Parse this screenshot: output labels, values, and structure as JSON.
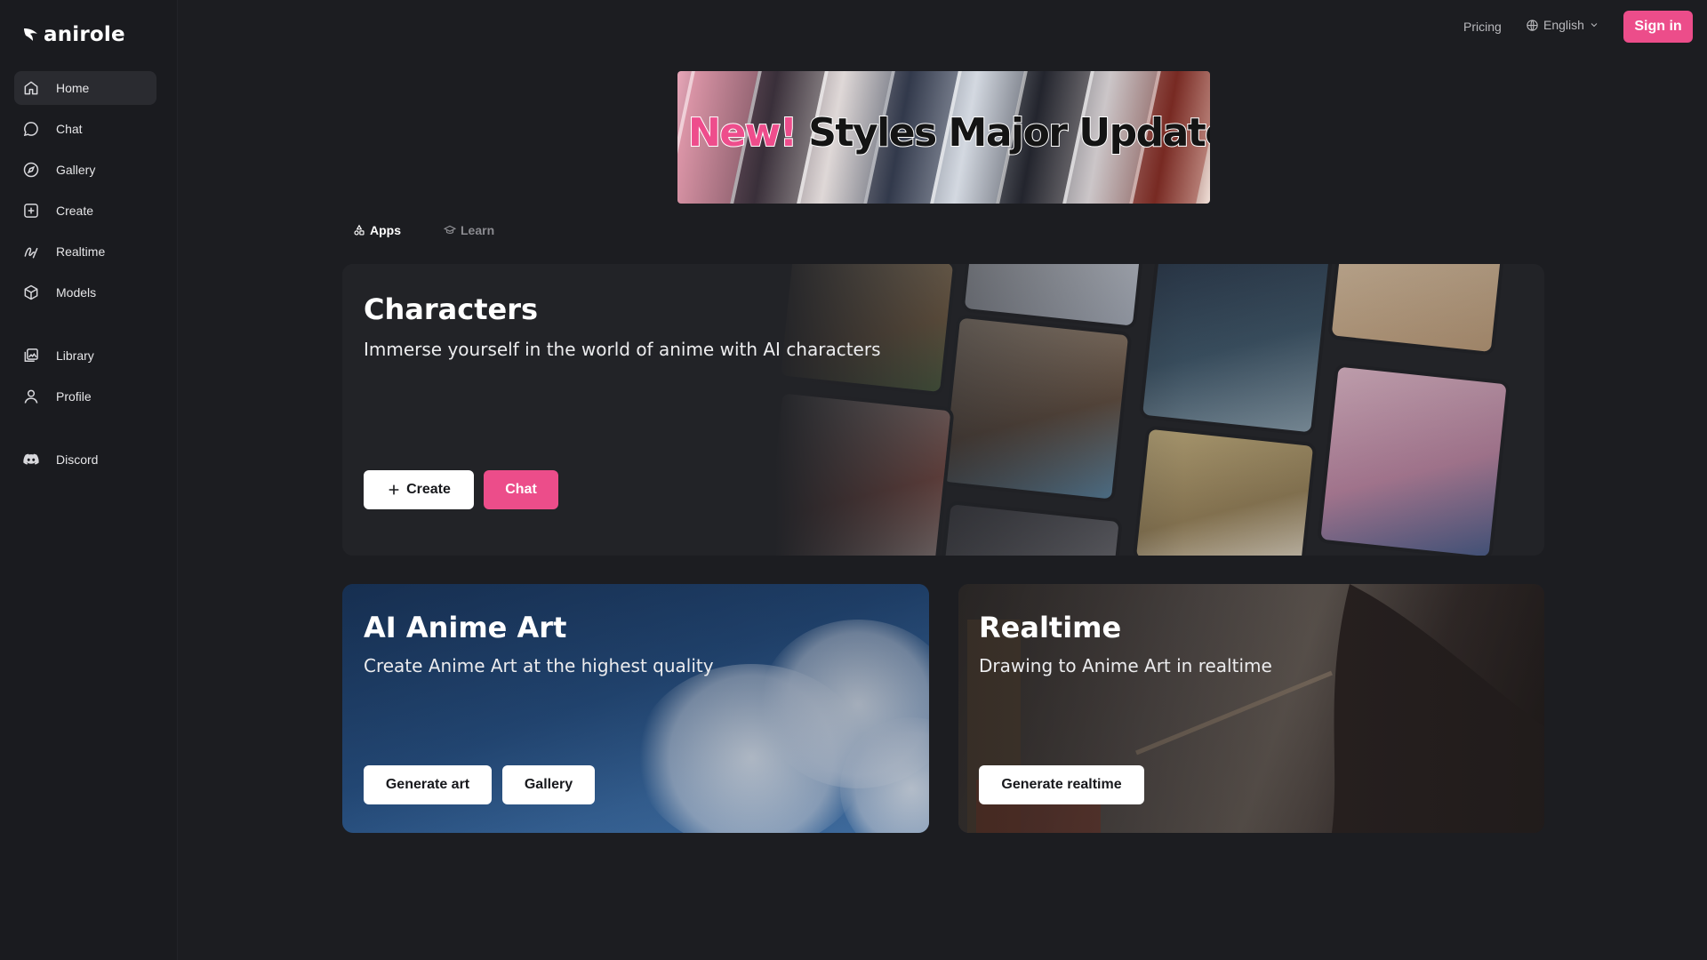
{
  "brand": {
    "name": "anirole"
  },
  "sidebar": {
    "items": [
      {
        "key": "home",
        "label": "Home",
        "icon": "home-icon",
        "active": true
      },
      {
        "key": "chat",
        "label": "Chat",
        "icon": "chat-bubble-icon"
      },
      {
        "key": "gallery",
        "label": "Gallery",
        "icon": "compass-icon"
      },
      {
        "key": "create",
        "label": "Create",
        "icon": "plus-square-icon"
      },
      {
        "key": "realtime",
        "label": "Realtime",
        "icon": "pen-scribble-icon"
      },
      {
        "key": "models",
        "label": "Models",
        "icon": "cube-icon"
      },
      {
        "key": "library",
        "label": "Library",
        "icon": "image-stack-icon"
      },
      {
        "key": "profile",
        "label": "Profile",
        "icon": "user-icon"
      },
      {
        "key": "discord",
        "label": "Discord",
        "icon": "discord-icon"
      }
    ]
  },
  "header": {
    "pricing": "Pricing",
    "language": "English",
    "sign_in": "Sign in"
  },
  "banner": {
    "highlight": "New!",
    "text": "Styles Major Update"
  },
  "tabs": [
    {
      "label": "Apps",
      "icon": "apps-icon",
      "active": true
    },
    {
      "label": "Learn",
      "icon": "graduation-cap-icon",
      "active": false
    }
  ],
  "cards": {
    "characters": {
      "title": "Characters",
      "subtitle": "Immerse yourself in the world of anime with AI characters",
      "create_label": "Create",
      "chat_label": "Chat"
    },
    "art": {
      "title": "AI Anime Art",
      "subtitle": "Create Anime Art at the highest quality",
      "generate_label": "Generate art",
      "gallery_label": "Gallery"
    },
    "realtime": {
      "title": "Realtime",
      "subtitle": "Drawing to Anime Art in realtime",
      "generate_label": "Generate realtime"
    }
  },
  "colors": {
    "accent": "#ec4d8a",
    "background": "#1c1d21",
    "sidebar": "#1a1b1f"
  }
}
